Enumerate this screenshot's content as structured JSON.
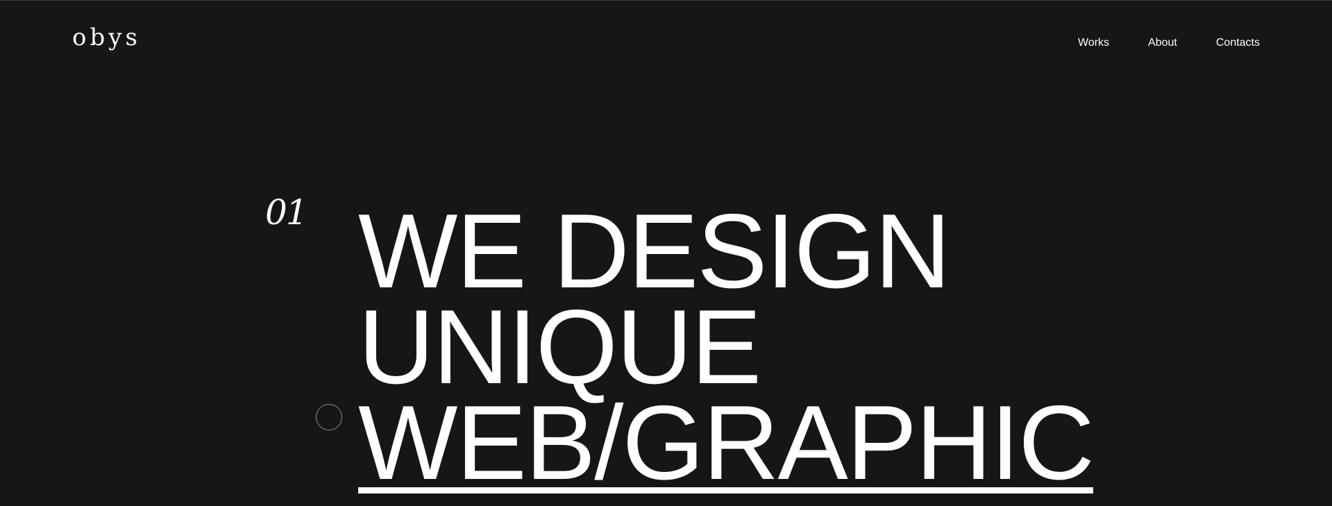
{
  "brand": {
    "logo_text": "obys"
  },
  "nav": {
    "items": [
      {
        "label": "Works"
      },
      {
        "label": "About"
      },
      {
        "label": "Contacts"
      }
    ]
  },
  "hero": {
    "number": "01",
    "lines": [
      "WE DESIGN",
      "UNIQUE",
      "WEB/GRAPHIC"
    ]
  },
  "colors": {
    "background": "#161616",
    "text": "#ffffff"
  }
}
